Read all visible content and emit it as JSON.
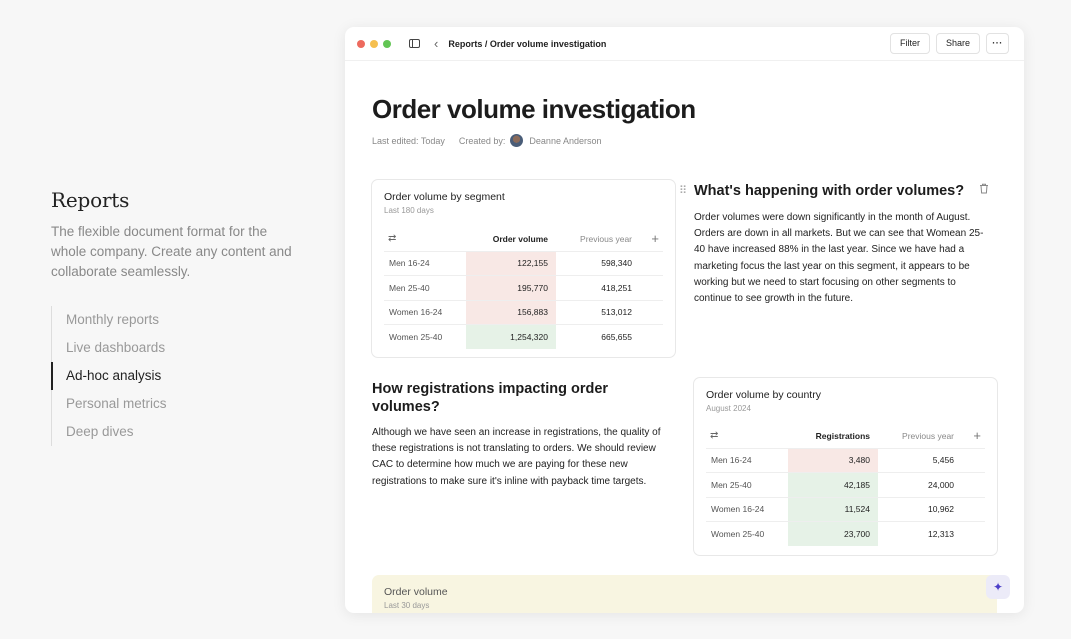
{
  "left": {
    "title": "Reports",
    "description": "The flexible document format for the whole company. Create any content and collaborate seamlessly.",
    "nav": [
      "Monthly reports",
      "Live dashboards",
      "Ad-hoc analysis",
      "Personal metrics",
      "Deep dives"
    ],
    "active_index": 2
  },
  "titlebar": {
    "breadcrumb": "Reports / Order volume investigation",
    "filter": "Filter",
    "share": "Share",
    "more": "···"
  },
  "doc": {
    "title": "Order volume investigation",
    "last_edited": "Last edited: Today",
    "created_by_label": "Created by:",
    "author": "Deanne Anderson"
  },
  "segment_table": {
    "title": "Order volume by segment",
    "subtitle": "Last 180 days",
    "col1": "Order volume",
    "col2": "Previous year",
    "rows": [
      {
        "label": "Men 16-24",
        "value": "122,155",
        "prev": "598,340",
        "tone": "red"
      },
      {
        "label": "Men 25-40",
        "value": "195,770",
        "prev": "418,251",
        "tone": "red"
      },
      {
        "label": "Women 16-24",
        "value": "156,883",
        "prev": "513,012",
        "tone": "red"
      },
      {
        "label": "Women 25-40",
        "value": "1,254,320",
        "prev": "665,655",
        "tone": "green"
      }
    ]
  },
  "whats_happening": {
    "title": "What's happening with order volumes?",
    "body": "Order volumes were down significantly in the month of August. Orders are down in all markets. But we can see that Womean 25-40 have increased 88% in the last year. Since we have had a marketing focus the last year on this segment, it appears to be working but we need to start focusing on other segments to continue to see growth in the future."
  },
  "registrations": {
    "title": "How registrations impacting order volumes?",
    "body": "Although we have seen an increase in registrations, the quality of these registrations is not translating to orders. We should review CAC to determine how much we are paying for these new registrations to make sure it's inline with payback time targets."
  },
  "country_table": {
    "title": "Order volume by country",
    "subtitle": "August 2024",
    "col1": "Registrations",
    "col2": "Previous year",
    "rows": [
      {
        "label": "Men 16-24",
        "value": "3,480",
        "prev": "5,456",
        "tone": "red"
      },
      {
        "label": "Men 25-40",
        "value": "42,185",
        "prev": "24,000",
        "tone": "green"
      },
      {
        "label": "Women 16-24",
        "value": "11,524",
        "prev": "10,962",
        "tone": "green"
      },
      {
        "label": "Women 25-40",
        "value": "23,700",
        "prev": "12,313",
        "tone": "green"
      }
    ]
  },
  "bottom_card": {
    "title": "Order volume",
    "subtitle": "Last 30 days"
  },
  "icons": {
    "sort": "⇄",
    "plus": "+",
    "back": "‹",
    "drag": "⠿",
    "trash": "🗑",
    "sparkle": "✦"
  }
}
